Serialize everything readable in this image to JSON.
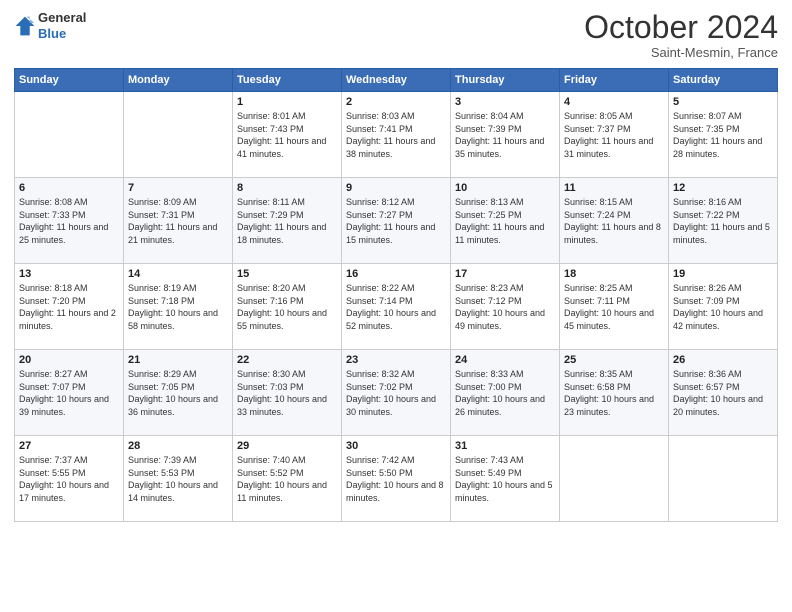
{
  "logo": {
    "general": "General",
    "blue": "Blue"
  },
  "header": {
    "month": "October 2024",
    "location": "Saint-Mesmin, France"
  },
  "days_of_week": [
    "Sunday",
    "Monday",
    "Tuesday",
    "Wednesday",
    "Thursday",
    "Friday",
    "Saturday"
  ],
  "weeks": [
    [
      {
        "day": "",
        "info": ""
      },
      {
        "day": "",
        "info": ""
      },
      {
        "day": "1",
        "info": "Sunrise: 8:01 AM\nSunset: 7:43 PM\nDaylight: 11 hours and 41 minutes."
      },
      {
        "day": "2",
        "info": "Sunrise: 8:03 AM\nSunset: 7:41 PM\nDaylight: 11 hours and 38 minutes."
      },
      {
        "day": "3",
        "info": "Sunrise: 8:04 AM\nSunset: 7:39 PM\nDaylight: 11 hours and 35 minutes."
      },
      {
        "day": "4",
        "info": "Sunrise: 8:05 AM\nSunset: 7:37 PM\nDaylight: 11 hours and 31 minutes."
      },
      {
        "day": "5",
        "info": "Sunrise: 8:07 AM\nSunset: 7:35 PM\nDaylight: 11 hours and 28 minutes."
      }
    ],
    [
      {
        "day": "6",
        "info": "Sunrise: 8:08 AM\nSunset: 7:33 PM\nDaylight: 11 hours and 25 minutes."
      },
      {
        "day": "7",
        "info": "Sunrise: 8:09 AM\nSunset: 7:31 PM\nDaylight: 11 hours and 21 minutes."
      },
      {
        "day": "8",
        "info": "Sunrise: 8:11 AM\nSunset: 7:29 PM\nDaylight: 11 hours and 18 minutes."
      },
      {
        "day": "9",
        "info": "Sunrise: 8:12 AM\nSunset: 7:27 PM\nDaylight: 11 hours and 15 minutes."
      },
      {
        "day": "10",
        "info": "Sunrise: 8:13 AM\nSunset: 7:25 PM\nDaylight: 11 hours and 11 minutes."
      },
      {
        "day": "11",
        "info": "Sunrise: 8:15 AM\nSunset: 7:24 PM\nDaylight: 11 hours and 8 minutes."
      },
      {
        "day": "12",
        "info": "Sunrise: 8:16 AM\nSunset: 7:22 PM\nDaylight: 11 hours and 5 minutes."
      }
    ],
    [
      {
        "day": "13",
        "info": "Sunrise: 8:18 AM\nSunset: 7:20 PM\nDaylight: 11 hours and 2 minutes."
      },
      {
        "day": "14",
        "info": "Sunrise: 8:19 AM\nSunset: 7:18 PM\nDaylight: 10 hours and 58 minutes."
      },
      {
        "day": "15",
        "info": "Sunrise: 8:20 AM\nSunset: 7:16 PM\nDaylight: 10 hours and 55 minutes."
      },
      {
        "day": "16",
        "info": "Sunrise: 8:22 AM\nSunset: 7:14 PM\nDaylight: 10 hours and 52 minutes."
      },
      {
        "day": "17",
        "info": "Sunrise: 8:23 AM\nSunset: 7:12 PM\nDaylight: 10 hours and 49 minutes."
      },
      {
        "day": "18",
        "info": "Sunrise: 8:25 AM\nSunset: 7:11 PM\nDaylight: 10 hours and 45 minutes."
      },
      {
        "day": "19",
        "info": "Sunrise: 8:26 AM\nSunset: 7:09 PM\nDaylight: 10 hours and 42 minutes."
      }
    ],
    [
      {
        "day": "20",
        "info": "Sunrise: 8:27 AM\nSunset: 7:07 PM\nDaylight: 10 hours and 39 minutes."
      },
      {
        "day": "21",
        "info": "Sunrise: 8:29 AM\nSunset: 7:05 PM\nDaylight: 10 hours and 36 minutes."
      },
      {
        "day": "22",
        "info": "Sunrise: 8:30 AM\nSunset: 7:03 PM\nDaylight: 10 hours and 33 minutes."
      },
      {
        "day": "23",
        "info": "Sunrise: 8:32 AM\nSunset: 7:02 PM\nDaylight: 10 hours and 30 minutes."
      },
      {
        "day": "24",
        "info": "Sunrise: 8:33 AM\nSunset: 7:00 PM\nDaylight: 10 hours and 26 minutes."
      },
      {
        "day": "25",
        "info": "Sunrise: 8:35 AM\nSunset: 6:58 PM\nDaylight: 10 hours and 23 minutes."
      },
      {
        "day": "26",
        "info": "Sunrise: 8:36 AM\nSunset: 6:57 PM\nDaylight: 10 hours and 20 minutes."
      }
    ],
    [
      {
        "day": "27",
        "info": "Sunrise: 7:37 AM\nSunset: 5:55 PM\nDaylight: 10 hours and 17 minutes."
      },
      {
        "day": "28",
        "info": "Sunrise: 7:39 AM\nSunset: 5:53 PM\nDaylight: 10 hours and 14 minutes."
      },
      {
        "day": "29",
        "info": "Sunrise: 7:40 AM\nSunset: 5:52 PM\nDaylight: 10 hours and 11 minutes."
      },
      {
        "day": "30",
        "info": "Sunrise: 7:42 AM\nSunset: 5:50 PM\nDaylight: 10 hours and 8 minutes."
      },
      {
        "day": "31",
        "info": "Sunrise: 7:43 AM\nSunset: 5:49 PM\nDaylight: 10 hours and 5 minutes."
      },
      {
        "day": "",
        "info": ""
      },
      {
        "day": "",
        "info": ""
      }
    ]
  ]
}
